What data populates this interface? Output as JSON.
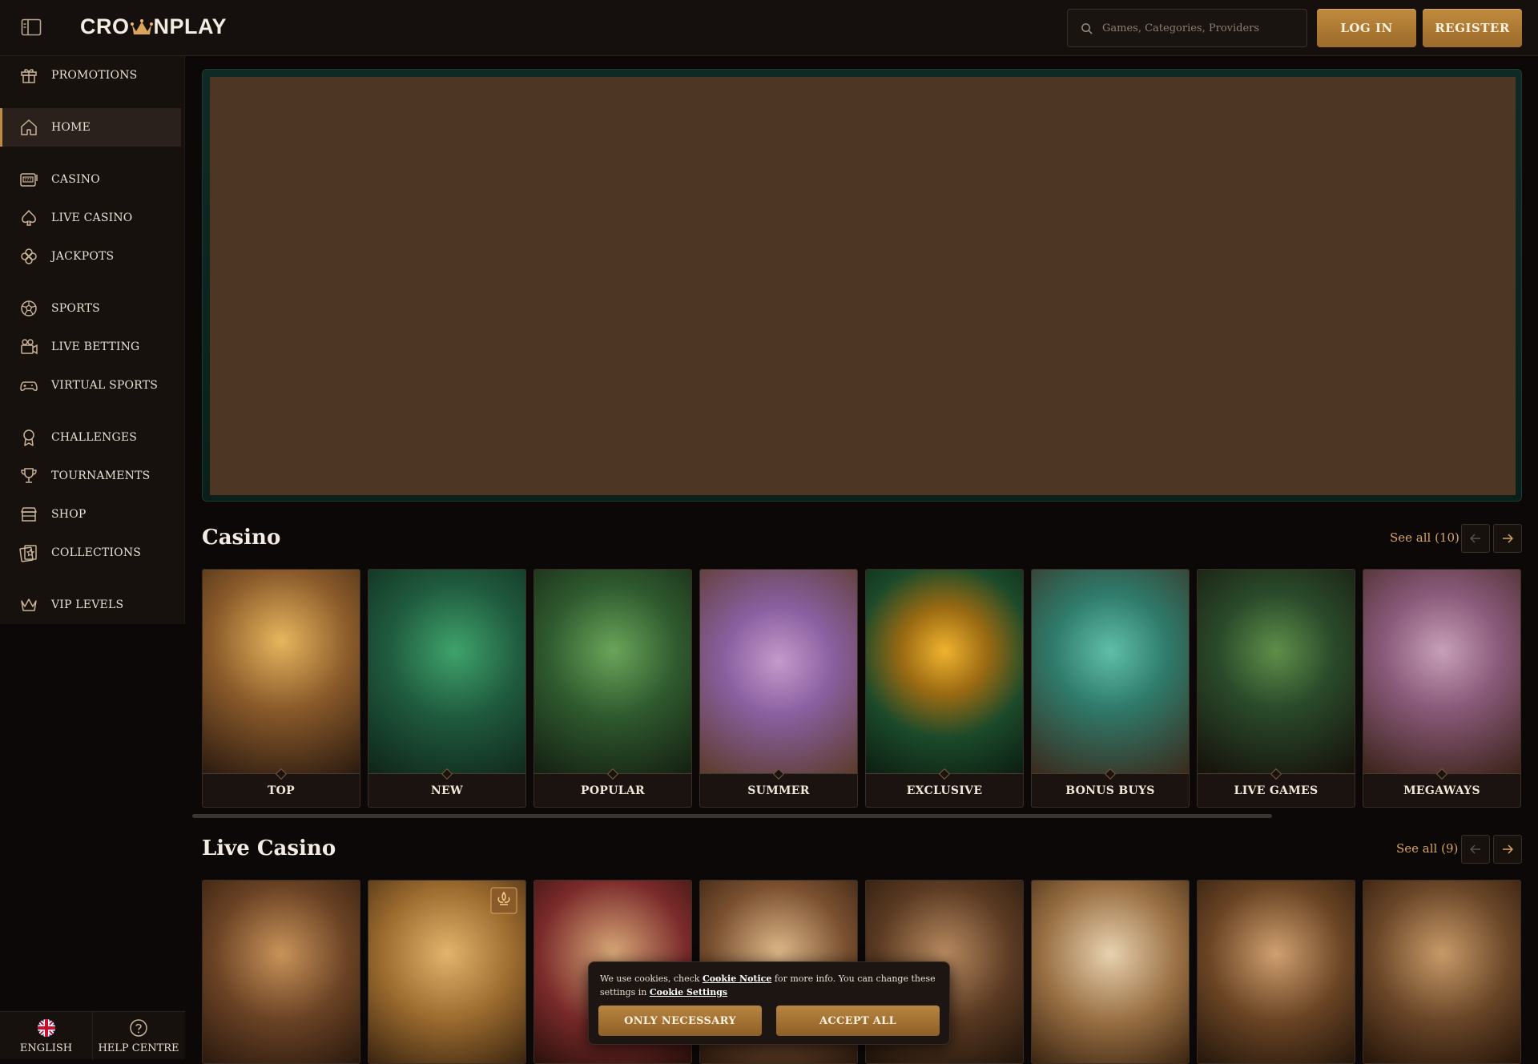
{
  "header": {
    "logo_text_left": "CRO",
    "logo_text_right": "NPLAY",
    "search_placeholder": "Games, Categories, Providers",
    "login_label": "LOG IN",
    "register_label": "REGISTER"
  },
  "sidebar": {
    "items": [
      {
        "label": "PROMOTIONS",
        "icon": "gift-icon"
      },
      {
        "label": "HOME",
        "icon": "home-icon",
        "active": true
      },
      {
        "label": "CASINO",
        "icon": "slot-machine-icon"
      },
      {
        "label": "LIVE CASINO",
        "icon": "spade-icon"
      },
      {
        "label": "JACKPOTS",
        "icon": "clover-icon"
      },
      {
        "label": "SPORTS",
        "icon": "soccer-ball-icon"
      },
      {
        "label": "LIVE BETTING",
        "icon": "live-camera-icon"
      },
      {
        "label": "VIRTUAL SPORTS",
        "icon": "gamepad-icon"
      },
      {
        "label": "CHALLENGES",
        "icon": "medal-icon"
      },
      {
        "label": "TOURNAMENTS",
        "icon": "trophy-icon"
      },
      {
        "label": "SHOP",
        "icon": "store-icon"
      },
      {
        "label": "COLLECTIONS",
        "icon": "collection-icon"
      },
      {
        "label": "VIP LEVELS",
        "icon": "crown-icon"
      }
    ],
    "footer": {
      "language_label": "ENGLISH",
      "help_label": "HELP CENTRE"
    }
  },
  "casino": {
    "title": "Casino",
    "see_all": "See all (10)",
    "cards": [
      {
        "label": "TOP"
      },
      {
        "label": "NEW"
      },
      {
        "label": "POPULAR"
      },
      {
        "label": "SUMMER"
      },
      {
        "label": "EXCLUSIVE"
      },
      {
        "label": "BONUS BUYS"
      },
      {
        "label": "LIVE GAMES"
      },
      {
        "label": "MEGAWAYS"
      }
    ]
  },
  "live_casino": {
    "title": "Live Casino",
    "see_all": "See all (9)"
  },
  "cookie_banner": {
    "text_1": "We use cookies, check ",
    "link_1": "Cookie Notice",
    "text_2": " for more info. You can change these settings in ",
    "link_2": "Cookie Settings",
    "only_necessary_label": "ONLY NECESSARY",
    "accept_all_label": "ACCEPT ALL"
  },
  "colors": {
    "accent_gold": "#c08a3e",
    "background": "#0b0807",
    "sidebar_bg": "#17110e",
    "banner_placeholder": "#4e3624"
  }
}
